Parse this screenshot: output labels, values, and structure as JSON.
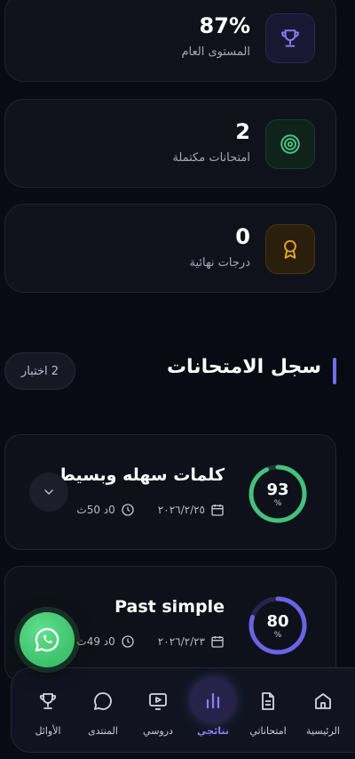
{
  "stats": [
    {
      "value": "87%",
      "label": "المستوى العام",
      "icon": "trophy-icon",
      "color": "#7b6cf6"
    },
    {
      "value": "2",
      "label": "امتحانات مكتملة",
      "icon": "target-icon",
      "color": "#3fb87a"
    },
    {
      "value": "0",
      "label": "درجات نهائية",
      "icon": "award-icon",
      "color": "#e0a21c"
    }
  ],
  "history": {
    "title": "سجل الامتحانات",
    "count": "2 اختبار"
  },
  "exams": [
    {
      "title": "كلمات سهله وبسيطه",
      "score": "93",
      "score_value": 93,
      "unit": "%",
      "date": "٢٠٢٦/٢/٢٥",
      "duration": "0د 50ث",
      "color": "#45c07e"
    },
    {
      "title": "Past simple",
      "score": "80",
      "score_value": 80,
      "unit": "%",
      "date": "٢٠٢٦/٢/٢٣",
      "duration": "0د 49ث",
      "color": "#6a63e6"
    }
  ],
  "nav": {
    "items": [
      {
        "label": "الرئيسية",
        "icon": "home-icon"
      },
      {
        "label": "امتحاناتي",
        "icon": "document-icon"
      },
      {
        "label": "نتائجي",
        "icon": "chart-bars-icon",
        "active": true
      },
      {
        "label": "دروسي",
        "icon": "video-icon"
      },
      {
        "label": "المنتدى",
        "icon": "chat-icon"
      },
      {
        "label": "الأوائل",
        "icon": "trophy-icon"
      }
    ]
  },
  "fab": {
    "icon": "whatsapp-icon"
  }
}
